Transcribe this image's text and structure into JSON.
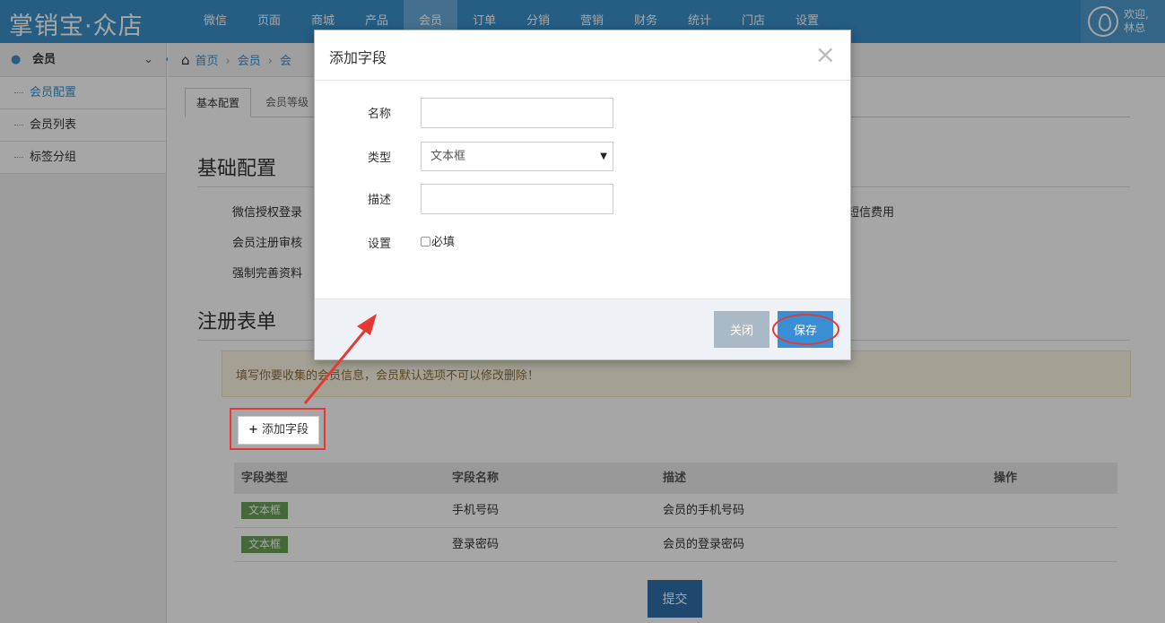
{
  "app": {
    "logo": "掌销宝·众店"
  },
  "nav": {
    "items": [
      "微信",
      "页面",
      "商城",
      "产品",
      "会员",
      "订单",
      "分销",
      "营销",
      "财务",
      "统计",
      "门店",
      "设置"
    ],
    "active_index": 4
  },
  "user": {
    "welcome_line1": "欢迎,",
    "welcome_line2": "林总"
  },
  "sidebar": {
    "header": "会员",
    "items": [
      "会员配置",
      "会员列表",
      "标签分组"
    ]
  },
  "breadcrumb": {
    "home": "首页",
    "item1": "会员",
    "item2": "会"
  },
  "tabs": [
    "基本配置",
    "会员等级"
  ],
  "basic": {
    "title": "基础配置",
    "labels": [
      "微信授权登录",
      "会员注册审核",
      "强制完善资料"
    ],
    "sms_text": "短信费用"
  },
  "register": {
    "title": "注册表单",
    "notice": "填写你要收集的会员信息，会员默认选项不可以修改删除！",
    "add_field_button": "添加字段",
    "table": {
      "headers": [
        "字段类型",
        "字段名称",
        "描述",
        "操作"
      ],
      "rows": [
        {
          "type": "文本框",
          "name": "手机号码",
          "desc": "会员的手机号码"
        },
        {
          "type": "文本框",
          "name": "登录密码",
          "desc": "会员的登录密码"
        }
      ]
    },
    "submit": "提交"
  },
  "modal": {
    "title": "添加字段",
    "fields": {
      "name_label": "名称",
      "name_value": "",
      "type_label": "类型",
      "type_value": "文本框",
      "desc_label": "描述",
      "desc_value": "",
      "setting_label": "设置",
      "required_label": "必填",
      "required_checked": false
    },
    "close_button": "关闭",
    "save_button": "保存"
  },
  "colors": {
    "primary": "#3a8fca",
    "annotation": "#e53935",
    "tag_green": "#6b9e58"
  }
}
